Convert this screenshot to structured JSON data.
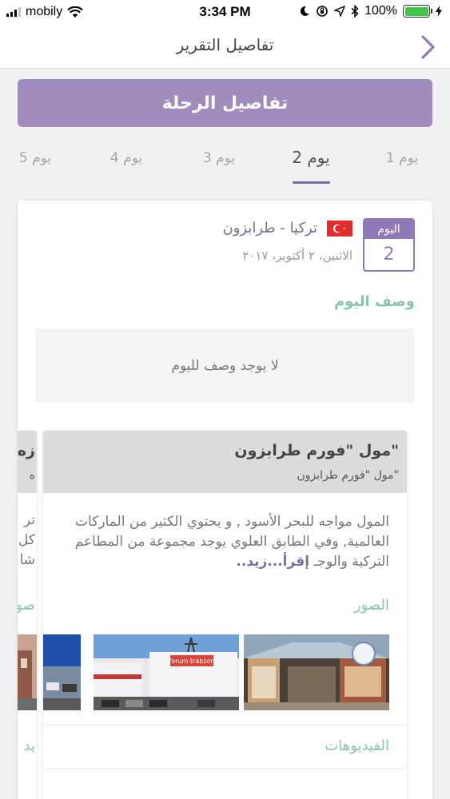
{
  "status_bar": {
    "carrier": "mobily",
    "time": "3:34 PM",
    "battery": "100%"
  },
  "nav": {
    "title": "تفاصيل التقرير"
  },
  "trip_button": "تفاصيل الرحلة",
  "tabs": [
    {
      "label": "يوم 1"
    },
    {
      "label": "يوم 2"
    },
    {
      "label": "يوم 3"
    },
    {
      "label": "يوم 4"
    },
    {
      "label": "يوم 5"
    }
  ],
  "day": {
    "badge_label": "اليوم",
    "badge_number": "2",
    "location": "تركيا - طرابزون",
    "date": "الاثنين، ٢ أكتوبر، ٢٠١٧"
  },
  "description": {
    "title": "وصف اليوم",
    "empty_text": "لا يوجد وصف لليوم"
  },
  "place": {
    "title": "مول \"فورم طرابزون\"",
    "subtitle": "مول \"فورم طرابزون\"",
    "description": "المول مواجه للبحر الأسود , و يحتوي الكثير من الماركات العالمية, وفي الطابق العلوي يوجد مجموعة من المطاعم التركية والوجـ",
    "read_more": "إقرأ...زيد..",
    "photos_label": "الصور",
    "videos_label": "الفيديوهات",
    "photo_sign": "forum trabzon"
  },
  "side_card_fragments": {
    "title": "زه",
    "subtitle": "ه",
    "line1": "تر",
    "line2": "كل",
    "line3": "شا",
    "photos": "صو",
    "videos": "يد"
  },
  "colors": {
    "primary": "#a08cbd",
    "accent": "#8f79b7",
    "green": "#8ac4ab"
  }
}
